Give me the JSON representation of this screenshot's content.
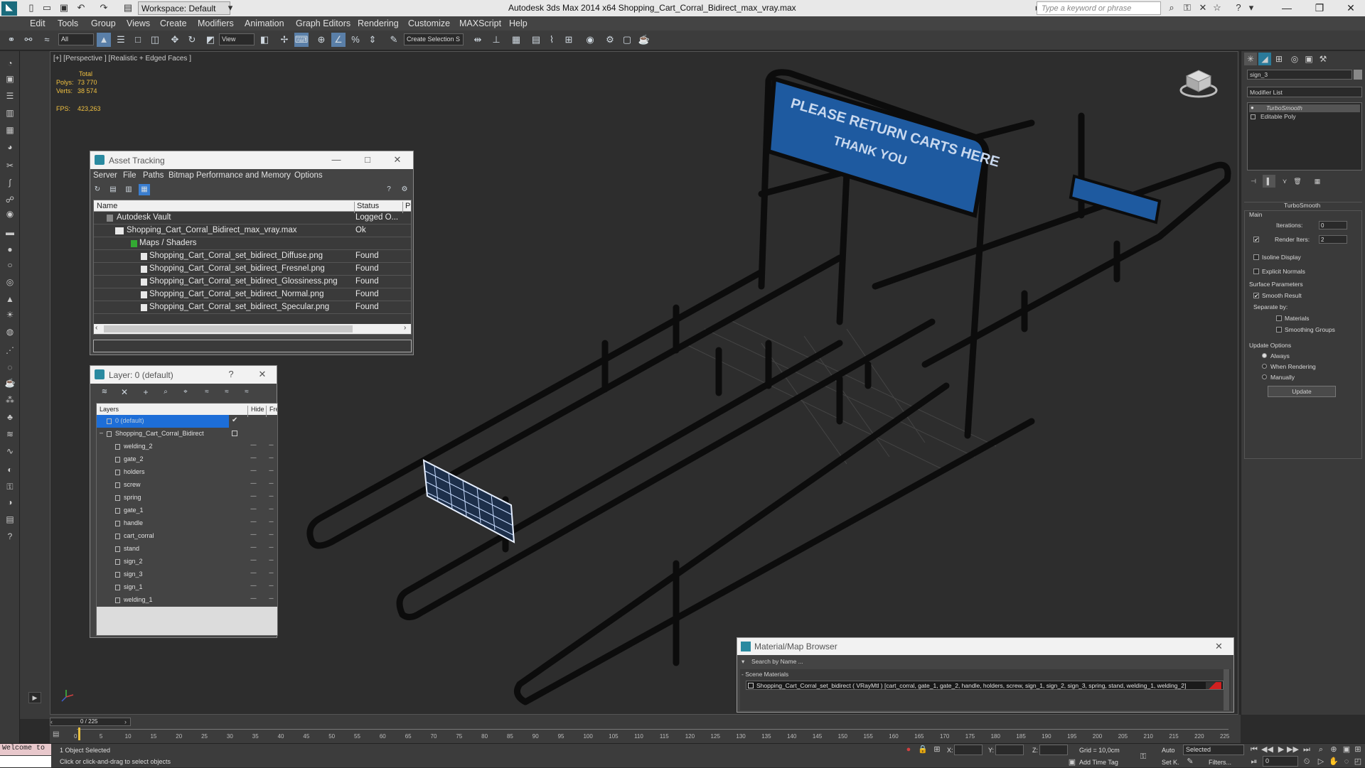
{
  "app": {
    "title": "Autodesk 3ds Max  2014 x64    Shopping_Cart_Corral_Bidirect_max_vray.max",
    "workspace": "Workspace: Default",
    "search_placeholder": "Type a keyword or phrase"
  },
  "menu": [
    "Edit",
    "Tools",
    "Group",
    "Views",
    "Create",
    "Modifiers",
    "Animation",
    "Graph Editors",
    "Rendering",
    "Customize",
    "MAXScript",
    "Help"
  ],
  "toolbar": {
    "selection_filter": "All",
    "ref_coord": "View",
    "named_selection": "Create Selection S"
  },
  "viewport": {
    "label": "[+] [Perspective ] [Realistic + Edged Faces ]",
    "stats": {
      "total_label": "Total",
      "polys_label": "Polys:",
      "polys_value": "73 770",
      "verts_label": "Verts:",
      "verts_value": "38 574",
      "fps_label": "FPS:",
      "fps_value": "423,263"
    },
    "sign_line1": "PLEASE RETURN CARTS HERE",
    "sign_line2": "THANK YOU"
  },
  "asset_tracking": {
    "title": "Asset Tracking",
    "menu": [
      "Server",
      "File",
      "Paths",
      "Bitmap Performance and Memory",
      "Options"
    ],
    "columns": [
      "Name",
      "Status",
      "Pro"
    ],
    "rows": [
      {
        "name": "Autodesk Vault",
        "status": "Logged O..."
      },
      {
        "name": "Shopping_Cart_Corral_Bidirect_max_vray.max",
        "status": "Ok"
      },
      {
        "name": "Maps / Shaders",
        "status": ""
      },
      {
        "name": "Shopping_Cart_Corral_set_bidirect_Diffuse.png",
        "status": "Found"
      },
      {
        "name": "Shopping_Cart_Corral_set_bidirect_Fresnel.png",
        "status": "Found"
      },
      {
        "name": "Shopping_Cart_Corral_set_bidirect_Glossiness.png",
        "status": "Found"
      },
      {
        "name": "Shopping_Cart_Corral_set_bidirect_Normal.png",
        "status": "Found"
      },
      {
        "name": "Shopping_Cart_Corral_set_bidirect_Specular.png",
        "status": "Found"
      }
    ]
  },
  "layer_dialog": {
    "title": "Layer: 0 (default)",
    "help": "?",
    "columns": [
      "Layers",
      "Hide",
      "Free"
    ],
    "layers": [
      {
        "name": "0 (default)",
        "level": 0
      },
      {
        "name": "Shopping_Cart_Corral_Bidirect",
        "level": 0
      },
      {
        "name": "welding_2",
        "level": 1
      },
      {
        "name": "gate_2",
        "level": 1
      },
      {
        "name": "holders",
        "level": 1
      },
      {
        "name": "screw",
        "level": 1
      },
      {
        "name": "spring",
        "level": 1
      },
      {
        "name": "gate_1",
        "level": 1
      },
      {
        "name": "handle",
        "level": 1
      },
      {
        "name": "cart_corral",
        "level": 1
      },
      {
        "name": "stand",
        "level": 1
      },
      {
        "name": "sign_2",
        "level": 1
      },
      {
        "name": "sign_3",
        "level": 1
      },
      {
        "name": "sign_1",
        "level": 1
      },
      {
        "name": "welding_1",
        "level": 1
      }
    ]
  },
  "command_panel": {
    "object_name": "sign_3",
    "modifier_list": "Modifier List",
    "stack": [
      "TurboSmooth",
      "Editable Poly"
    ],
    "turbosmooth": {
      "title": "TurboSmooth",
      "main": "Main",
      "iterations_label": "Iterations:",
      "iterations_value": "0",
      "render_iters_label": "Render Iters:",
      "render_iters_value": "2",
      "isoline": "Isoline Display",
      "explicit": "Explicit Normals",
      "surface_params": "Surface Parameters",
      "smooth_result": "Smooth Result",
      "separate_by": "Separate by:",
      "materials": "Materials",
      "smoothing_groups": "Smoothing Groups",
      "update_options": "Update Options",
      "always": "Always",
      "when_rendering": "When Rendering",
      "manually": "Manually",
      "update_btn": "Update"
    }
  },
  "material_browser": {
    "title": "Material/Map Browser",
    "search_placeholder": "Search by Name ...",
    "section": "- Scene Materials",
    "entry": "Shopping_Cart_Corral_set_bidirect  ( VRayMtl ) [cart_corral, gate_1, gate_2, handle, holders, screw, sign_1, sign_2, sign_3, spring, stand, welding_1, welding_2]"
  },
  "timeline": {
    "frame": "0 / 225",
    "ticks": [
      "0",
      "5",
      "10",
      "15",
      "20",
      "25",
      "30",
      "35",
      "40",
      "45",
      "50",
      "55",
      "60",
      "65",
      "70",
      "75",
      "80",
      "85",
      "90",
      "95",
      "100",
      "105",
      "110",
      "115",
      "120",
      "125",
      "130",
      "135",
      "140",
      "145",
      "150",
      "155",
      "160",
      "165",
      "170",
      "175",
      "180",
      "185",
      "190",
      "195",
      "200",
      "205",
      "210",
      "215",
      "220",
      "225"
    ]
  },
  "status": {
    "welcome": "Welcome to",
    "selected": "1 Object Selected",
    "prompt": "Click or click-and-drag to select objects",
    "x_label": "X:",
    "y_label": "Y:",
    "z_label": "Z:",
    "grid": "Grid = 10,0cm",
    "auto": "Auto",
    "set_key": "Set K.",
    "selected_dd": "Selected",
    "filters": "Filters...",
    "add_time_tag": "Add Time Tag",
    "frame_value": "0"
  },
  "colors": {
    "sign_blue": "#1e5aa0",
    "selection_blue": "#1d6ed8",
    "stat_yellow": "#f0c040"
  }
}
